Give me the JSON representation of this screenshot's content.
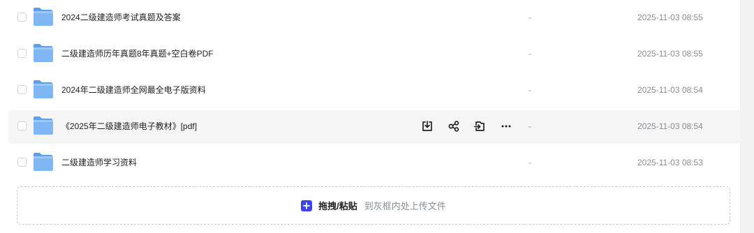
{
  "files": [
    {
      "name": "2024二级建造师考试真题及答案",
      "size": "-",
      "modified": "2025-11-03 08:55",
      "hover": false
    },
    {
      "name": "二级建造师历年真题8年真题+空白卷PDF",
      "size": "-",
      "modified": "2025-11-03 08:55",
      "hover": false
    },
    {
      "name": "2024年二级建造师全网最全电子版资料",
      "size": "-",
      "modified": "2025-11-03 08:54",
      "hover": false
    },
    {
      "name": "《2025年二级建造师电子教材》[pdf]",
      "size": "-",
      "modified": "2025-11-03 08:54",
      "hover": true
    },
    {
      "name": "二级建造师学习资料",
      "size": "-",
      "modified": "2025-11-03 08:53",
      "hover": false
    }
  ],
  "row_actions": [
    {
      "name": "download-icon"
    },
    {
      "name": "share-icon"
    },
    {
      "name": "move-icon"
    },
    {
      "name": "more-icon"
    }
  ],
  "upload": {
    "main_label": "拖拽/粘贴",
    "hint": "到灰框内处上传文件",
    "plus_symbol": "+",
    "accent": "#3c44e8"
  },
  "colors": {
    "folder": "#7fb6f3",
    "hover_row": "#f5f5f6",
    "muted_text": "#8a8d93"
  }
}
